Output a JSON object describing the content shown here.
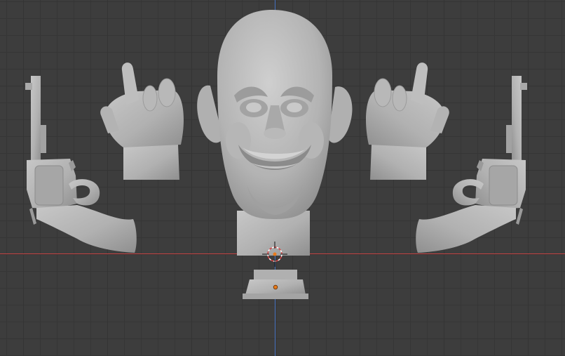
{
  "viewport": {
    "background": "#3d3d3d",
    "grid_color": "#343434",
    "mesh_color": "#b4b4b4",
    "x_axis_color": "#c84444",
    "z_axis_color": "#4a76c4",
    "origin_color": "#e87a1a"
  },
  "objects": [
    {
      "name": "revolver-left",
      "icon": "revolver-mesh"
    },
    {
      "name": "hand-left",
      "icon": "hand-gesture-mesh"
    },
    {
      "name": "smiling-head",
      "icon": "head-sculpt-mesh"
    },
    {
      "name": "hand-right",
      "icon": "hand-gesture-mesh"
    },
    {
      "name": "revolver-right",
      "icon": "revolver-mesh"
    },
    {
      "name": "stand-base",
      "icon": "base-mesh"
    }
  ],
  "cursor": {
    "icon": "3d-cursor-icon"
  }
}
